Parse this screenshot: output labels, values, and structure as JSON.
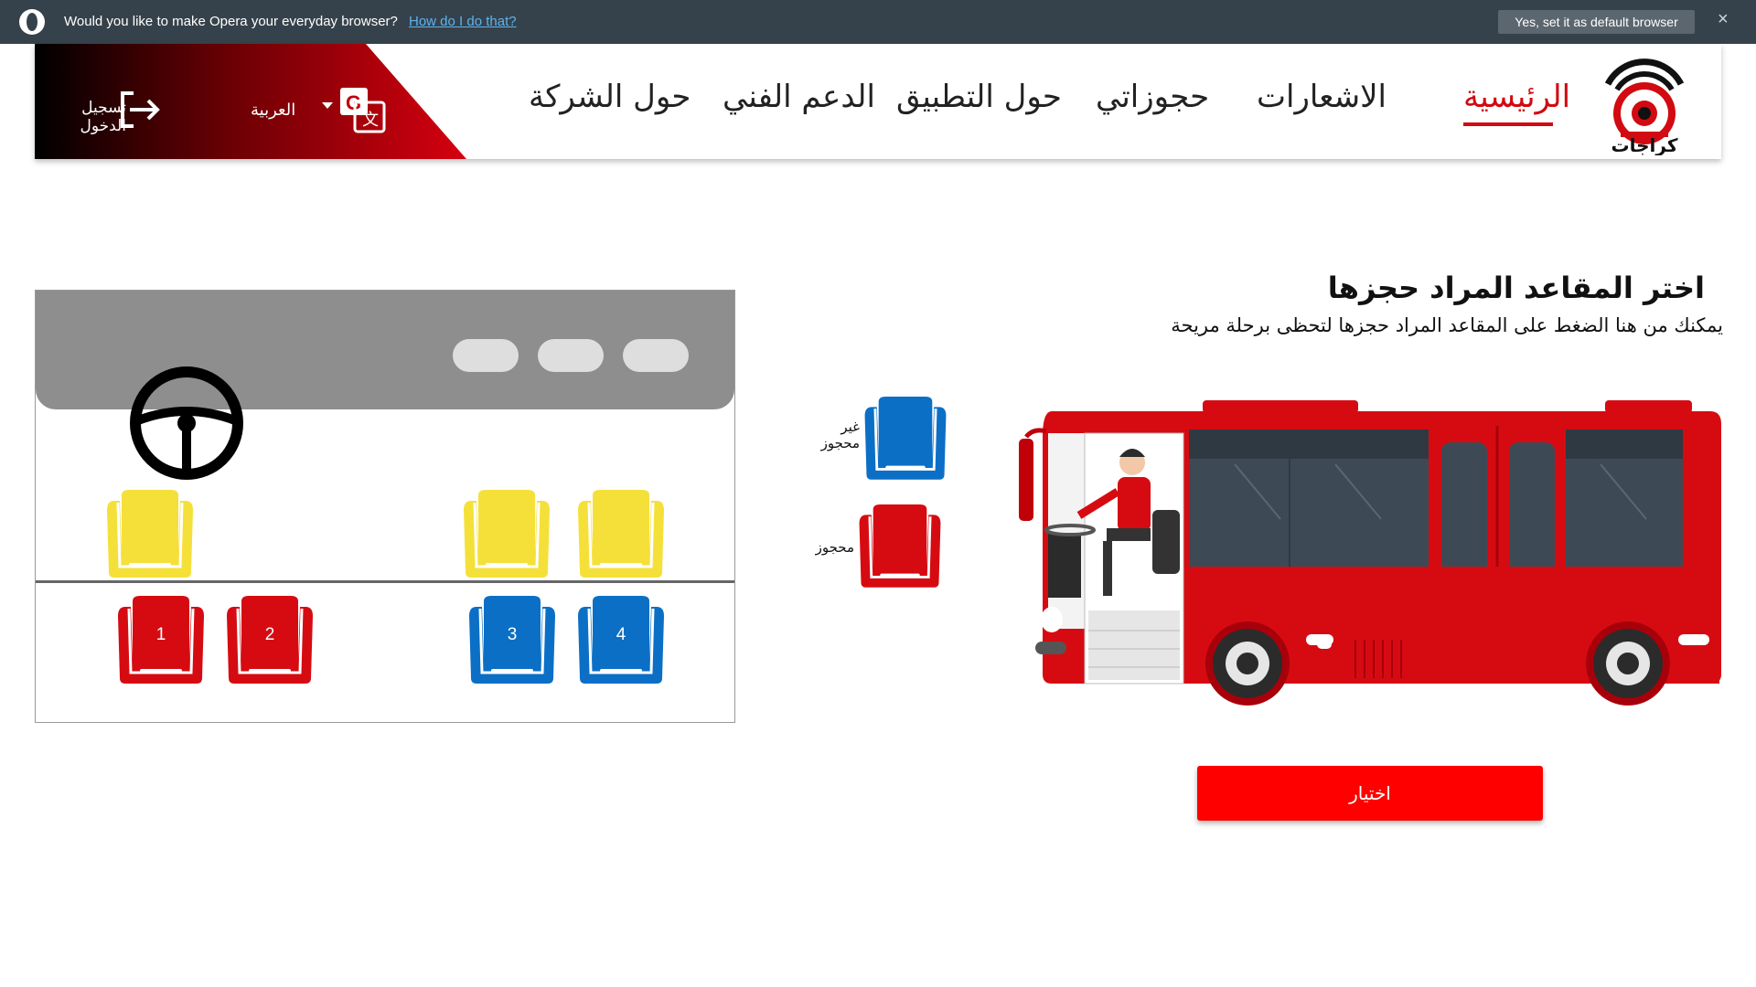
{
  "opera_bar": {
    "question": "Would you like to make Opera your everyday browser?",
    "link": "How do I do that?",
    "default_button": "Yes, set it as default browser",
    "close": "×",
    "logo_icon": "opera-logo-icon"
  },
  "header": {
    "login_label": "تسجيل الدخول",
    "language_label": "العربية",
    "icons": [
      "login-arrow-icon",
      "translate-icon",
      "chevron-down-icon",
      "karajat-bus-logo"
    ],
    "nav": [
      {
        "label": "الرئيسية",
        "active": true
      },
      {
        "label": "الاشعارات",
        "active": false
      },
      {
        "label": "حجوزاتي",
        "active": false
      },
      {
        "label": "حول التطبيق",
        "active": false
      },
      {
        "label": "الدعم الفني",
        "active": false
      },
      {
        "label": "حول الشركة",
        "active": false
      }
    ],
    "logo_text": "كراجات"
  },
  "main": {
    "title": "اختر المقاعد المراد حجزها",
    "subtitle": "يمكنك من هنا الضغط على المقاعد المراد حجزها لتحظى برحلة مريحة",
    "select_button": "اختيار"
  },
  "legend": {
    "available": "غير محجوز",
    "booked": "محجوز"
  },
  "seat_map": {
    "front_seats": [
      {
        "label": "",
        "status": "driver-area"
      },
      {
        "label": "",
        "status": "driver-area"
      },
      {
        "label": "",
        "status": "driver-area"
      }
    ],
    "passenger_seats": [
      {
        "label": "1",
        "status": "booked"
      },
      {
        "label": "2",
        "status": "booked"
      },
      {
        "label": "3",
        "status": "available"
      },
      {
        "label": "4",
        "status": "available"
      }
    ],
    "icons": [
      "steering-wheel-icon"
    ]
  },
  "colors": {
    "brand_red": "#d20a11",
    "button_red": "#ff0000",
    "seat_yellow": "#f5e03a",
    "seat_red": "#d60b12",
    "seat_blue": "#0b6fc6",
    "dashboard_gray": "#8e8e8e"
  }
}
